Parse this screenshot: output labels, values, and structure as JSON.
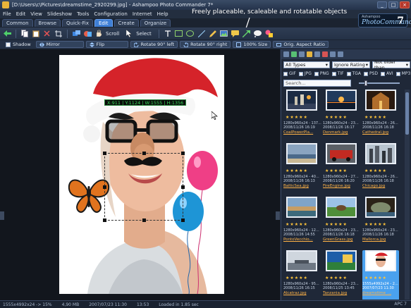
{
  "window": {
    "title": "[D:\\Users\\c\\Pictures\\dreamstime_2920299.jpg] - Ashampoo Photo Commander 7*",
    "controls": [
      "_",
      "□",
      "×"
    ]
  },
  "menu": [
    "File",
    "Edit",
    "View",
    "Slideshow",
    "Tools",
    "Configuration",
    "Internet",
    "Help"
  ],
  "annotation": "Freely placeable, scaleable and rotatable objects",
  "brand": {
    "small": "Ashampoo",
    "name": "PhotoCommander",
    "version": "7"
  },
  "mode_tabs": [
    {
      "label": "Common"
    },
    {
      "label": "Browse"
    },
    {
      "label": "Quick-Fix"
    },
    {
      "label": "Edit",
      "active": true
    },
    {
      "label": "Create"
    },
    {
      "label": "Organize"
    }
  ],
  "toolbar": {
    "scroll_label": "Scroll",
    "select_label": "Select"
  },
  "toolbar2": {
    "shadow": "Shadow",
    "mirror": "Mirror",
    "flip": "Flip",
    "rotate_left": "Rotate 90° left",
    "rotate_right": "Rotate 90° right",
    "size100": "100% Size",
    "orig_aspect": "Orig. Aspect Ratio"
  },
  "canvas": {
    "coords": "X:911 | Y:1124 | W:1555 | H:1356"
  },
  "browser": {
    "type_filter": "All Types",
    "rating_filter": "Ignore Rating",
    "age_filter": "Not older than...",
    "filetypes": [
      "GIF",
      "JPG",
      "PNG",
      "TIF",
      "TGA",
      "PSD",
      "AVI",
      "MP3"
    ],
    "search_placeholder": "Search..."
  },
  "thumbnails": [
    {
      "dims": "1280x960x24 - 137...",
      "date": "2008/11/26 16:19",
      "name": "CoalPowerPla...",
      "stars": "★★★★★"
    },
    {
      "dims": "1280x960x24 - 23...",
      "date": "2008/11/26 16:17",
      "name": "Denmark.jpg",
      "stars": "★★★★★"
    },
    {
      "dims": "1280x960x24 - 26...",
      "date": "2008/11/26 16:18",
      "name": "Cathedral.jpg",
      "stars": "★★★★★"
    },
    {
      "dims": "1280x960x24 - 40...",
      "date": "2008/11/26 16:13",
      "name": "BalticSea.jpg",
      "stars": "★★★★★"
    },
    {
      "dims": "1280x960x24 - 27...",
      "date": "2008/11/26 16:20",
      "name": "FireEngine.jpg",
      "stars": "★★★★★"
    },
    {
      "dims": "1280x960x24 - 26...",
      "date": "2008/11/26 16:18",
      "name": "Chicago.jpg",
      "stars": "★★★★★"
    },
    {
      "dims": "1280x960x24 - 12...",
      "date": "2008/11/26 14:55",
      "name": "PontoVecchio...",
      "stars": "★★★★★"
    },
    {
      "dims": "1280x960x24 - 23...",
      "date": "2008/11/26 16:18",
      "name": "GreenGrass.jpg",
      "stars": "★★★★★"
    },
    {
      "dims": "1280x960x24 - 23...",
      "date": "2008/11/26 16:18",
      "name": "Mallorca.jpg",
      "stars": "★★★★★"
    },
    {
      "dims": "1280x960x24 - 95...",
      "date": "2008/11/26 16:15",
      "name": "Alcatraz.jpg",
      "stars": "★★★★★"
    },
    {
      "dims": "1280x960x24 - 23...",
      "date": "2008/11/25 13:45",
      "name": "Tanzania.jpg",
      "stars": "★★★★★"
    },
    {
      "dims": "1555x4992x24 - 2...",
      "date": "2007/07/23 11:30",
      "name": "dreamstime_...",
      "stars": "★★★★★",
      "selected": true
    }
  ],
  "status": {
    "left": "1555x4992x24 -> 15%",
    "size": "4,90 MB",
    "date": "2007/07/23 11:30",
    "time": "13:53",
    "loaded": "Loaded in 1.85 sec",
    "right": "APC 7"
  }
}
